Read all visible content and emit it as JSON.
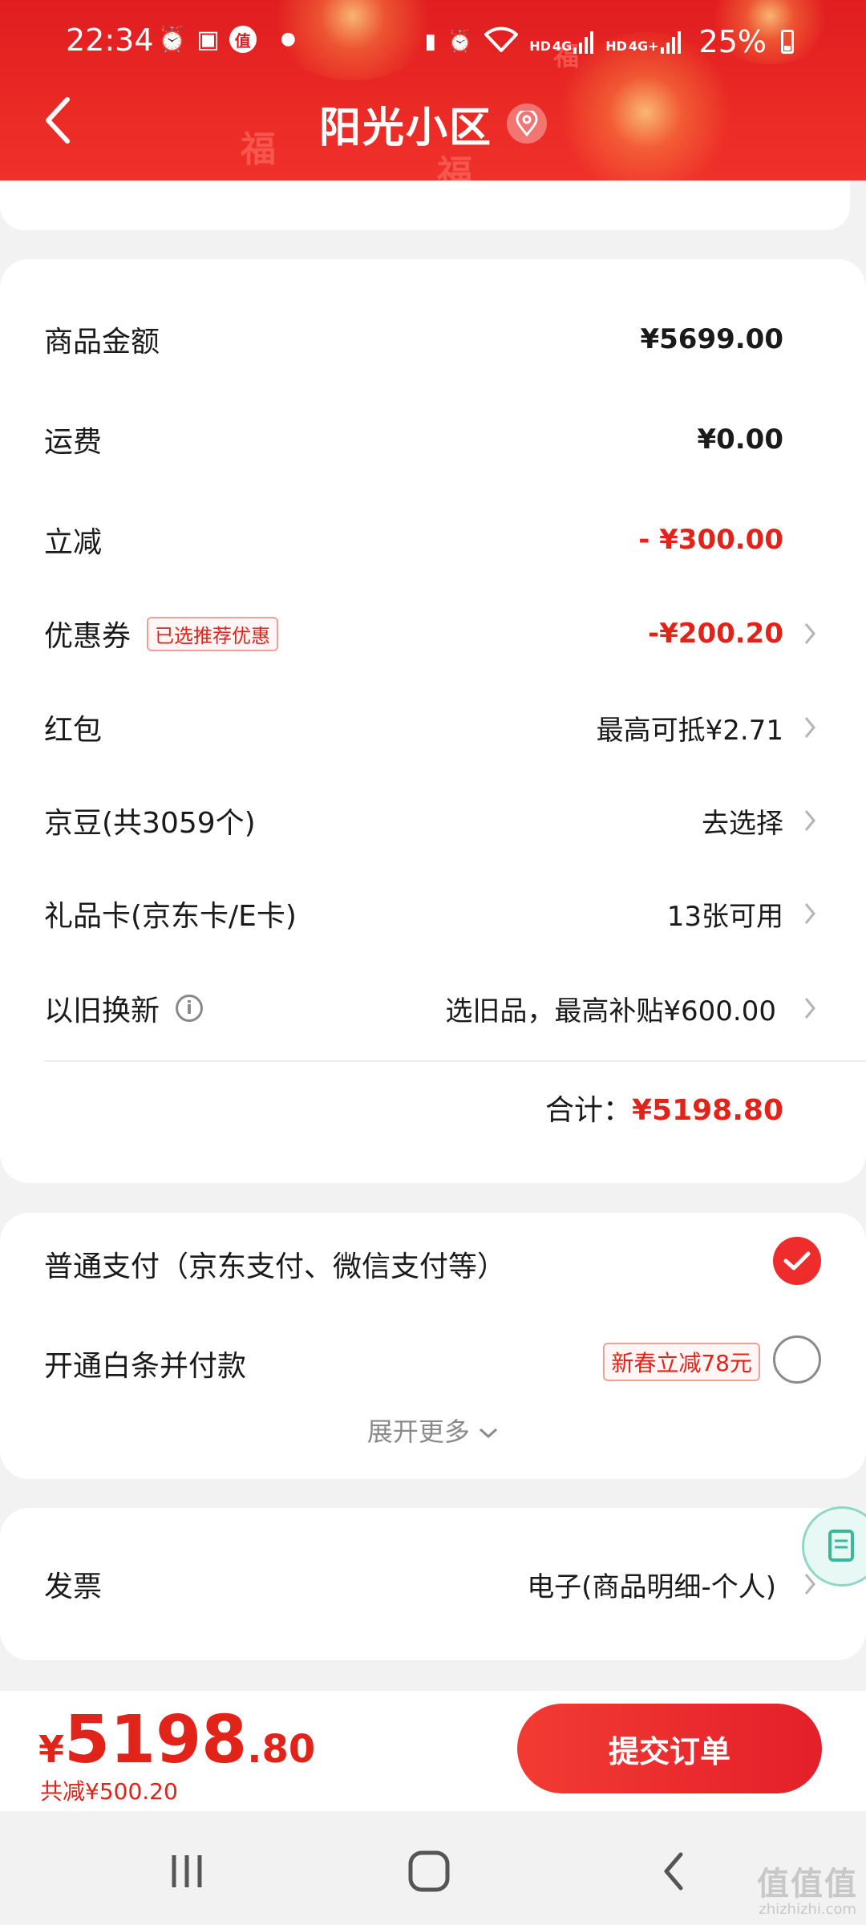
{
  "status_bar": {
    "time": "22:34",
    "battery": "25%",
    "left_icons": [
      "alarm-icon",
      "gallery-icon",
      "zhi-app-icon",
      "dot-icon"
    ],
    "right_icons": [
      "battery-saver-icon",
      "alarm-icon",
      "wifi-icon",
      "hd-4g-signal-icon",
      "hd-4g-signal-icon"
    ],
    "network_labels": [
      "HD",
      "4G",
      "HD",
      "4G+"
    ]
  },
  "header": {
    "title": "阳光小区",
    "back_icon": "chevron-left-icon",
    "location_icon": "location-pin-icon",
    "colors": {
      "background": "#e11d20",
      "text": "#ffffff"
    }
  },
  "summary": {
    "rows": [
      {
        "label": "商品金额",
        "value": "¥5699.00"
      },
      {
        "label": "运费",
        "value": "¥0.00"
      },
      {
        "label": "立减",
        "value": "- ¥300.00"
      },
      {
        "label": "优惠券",
        "tag": "已选推荐优惠",
        "value": "-¥200.20"
      },
      {
        "label": "红包",
        "value": "最高可抵¥2.71"
      },
      {
        "label": "京豆(共3059个)",
        "value": "去选择"
      },
      {
        "label": "礼品卡(京东卡/E卡)",
        "value": "13张可用"
      },
      {
        "label": "以旧换新",
        "value": "选旧品，最高补贴¥600.00"
      }
    ],
    "total_label": "合计：",
    "total_value": "¥5198.80"
  },
  "payment": {
    "options": [
      {
        "label": "普通支付（京东支付、微信支付等）",
        "selected": true
      },
      {
        "label": "开通白条并付款",
        "promo": "新春立减78元",
        "selected": false
      }
    ],
    "expand_label": "展开更多"
  },
  "invoice": {
    "label": "发票",
    "value": "电子(商品明细-个人)"
  },
  "bottom": {
    "currency": "¥",
    "price_int": "5198",
    "price_dec": ".80",
    "saved": "共减¥500.20",
    "submit_label": "提交订单"
  },
  "nav": {
    "icons": [
      "recent-apps-icon",
      "home-icon",
      "back-icon"
    ]
  },
  "watermark": {
    "text": "值值值",
    "sub": "zhizhizhi.com"
  },
  "colors": {
    "accent": "#e2231a",
    "page_bg": "#f2f2f2",
    "card_bg": "#ffffff"
  }
}
